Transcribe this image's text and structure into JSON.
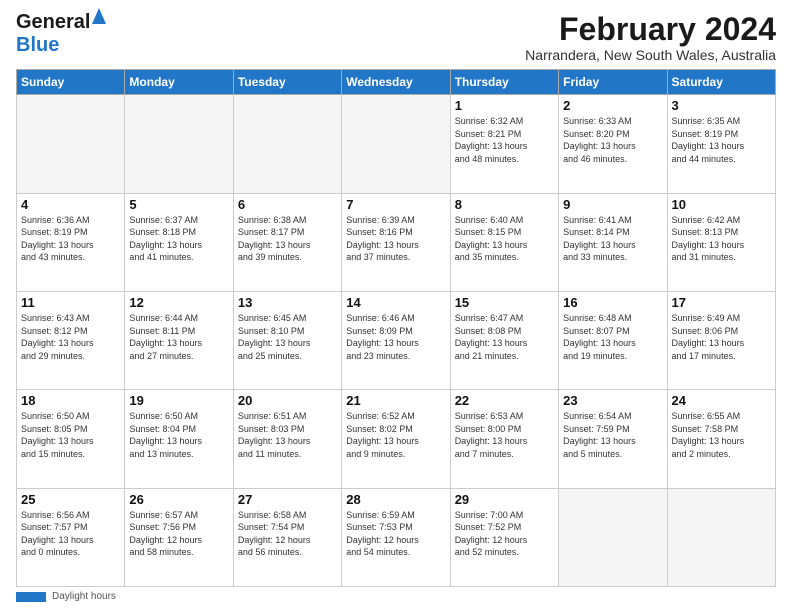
{
  "header": {
    "logo_line1": "General",
    "logo_line2": "Blue",
    "title": "February 2024",
    "subtitle": "Narrandera, New South Wales, Australia"
  },
  "days_of_week": [
    "Sunday",
    "Monday",
    "Tuesday",
    "Wednesday",
    "Thursday",
    "Friday",
    "Saturday"
  ],
  "weeks": [
    [
      {
        "day": "",
        "info": ""
      },
      {
        "day": "",
        "info": ""
      },
      {
        "day": "",
        "info": ""
      },
      {
        "day": "",
        "info": ""
      },
      {
        "day": "1",
        "info": "Sunrise: 6:32 AM\nSunset: 8:21 PM\nDaylight: 13 hours\nand 48 minutes."
      },
      {
        "day": "2",
        "info": "Sunrise: 6:33 AM\nSunset: 8:20 PM\nDaylight: 13 hours\nand 46 minutes."
      },
      {
        "day": "3",
        "info": "Sunrise: 6:35 AM\nSunset: 8:19 PM\nDaylight: 13 hours\nand 44 minutes."
      }
    ],
    [
      {
        "day": "4",
        "info": "Sunrise: 6:36 AM\nSunset: 8:19 PM\nDaylight: 13 hours\nand 43 minutes."
      },
      {
        "day": "5",
        "info": "Sunrise: 6:37 AM\nSunset: 8:18 PM\nDaylight: 13 hours\nand 41 minutes."
      },
      {
        "day": "6",
        "info": "Sunrise: 6:38 AM\nSunset: 8:17 PM\nDaylight: 13 hours\nand 39 minutes."
      },
      {
        "day": "7",
        "info": "Sunrise: 6:39 AM\nSunset: 8:16 PM\nDaylight: 13 hours\nand 37 minutes."
      },
      {
        "day": "8",
        "info": "Sunrise: 6:40 AM\nSunset: 8:15 PM\nDaylight: 13 hours\nand 35 minutes."
      },
      {
        "day": "9",
        "info": "Sunrise: 6:41 AM\nSunset: 8:14 PM\nDaylight: 13 hours\nand 33 minutes."
      },
      {
        "day": "10",
        "info": "Sunrise: 6:42 AM\nSunset: 8:13 PM\nDaylight: 13 hours\nand 31 minutes."
      }
    ],
    [
      {
        "day": "11",
        "info": "Sunrise: 6:43 AM\nSunset: 8:12 PM\nDaylight: 13 hours\nand 29 minutes."
      },
      {
        "day": "12",
        "info": "Sunrise: 6:44 AM\nSunset: 8:11 PM\nDaylight: 13 hours\nand 27 minutes."
      },
      {
        "day": "13",
        "info": "Sunrise: 6:45 AM\nSunset: 8:10 PM\nDaylight: 13 hours\nand 25 minutes."
      },
      {
        "day": "14",
        "info": "Sunrise: 6:46 AM\nSunset: 8:09 PM\nDaylight: 13 hours\nand 23 minutes."
      },
      {
        "day": "15",
        "info": "Sunrise: 6:47 AM\nSunset: 8:08 PM\nDaylight: 13 hours\nand 21 minutes."
      },
      {
        "day": "16",
        "info": "Sunrise: 6:48 AM\nSunset: 8:07 PM\nDaylight: 13 hours\nand 19 minutes."
      },
      {
        "day": "17",
        "info": "Sunrise: 6:49 AM\nSunset: 8:06 PM\nDaylight: 13 hours\nand 17 minutes."
      }
    ],
    [
      {
        "day": "18",
        "info": "Sunrise: 6:50 AM\nSunset: 8:05 PM\nDaylight: 13 hours\nand 15 minutes."
      },
      {
        "day": "19",
        "info": "Sunrise: 6:50 AM\nSunset: 8:04 PM\nDaylight: 13 hours\nand 13 minutes."
      },
      {
        "day": "20",
        "info": "Sunrise: 6:51 AM\nSunset: 8:03 PM\nDaylight: 13 hours\nand 11 minutes."
      },
      {
        "day": "21",
        "info": "Sunrise: 6:52 AM\nSunset: 8:02 PM\nDaylight: 13 hours\nand 9 minutes."
      },
      {
        "day": "22",
        "info": "Sunrise: 6:53 AM\nSunset: 8:00 PM\nDaylight: 13 hours\nand 7 minutes."
      },
      {
        "day": "23",
        "info": "Sunrise: 6:54 AM\nSunset: 7:59 PM\nDaylight: 13 hours\nand 5 minutes."
      },
      {
        "day": "24",
        "info": "Sunrise: 6:55 AM\nSunset: 7:58 PM\nDaylight: 13 hours\nand 2 minutes."
      }
    ],
    [
      {
        "day": "25",
        "info": "Sunrise: 6:56 AM\nSunset: 7:57 PM\nDaylight: 13 hours\nand 0 minutes."
      },
      {
        "day": "26",
        "info": "Sunrise: 6:57 AM\nSunset: 7:56 PM\nDaylight: 12 hours\nand 58 minutes."
      },
      {
        "day": "27",
        "info": "Sunrise: 6:58 AM\nSunset: 7:54 PM\nDaylight: 12 hours\nand 56 minutes."
      },
      {
        "day": "28",
        "info": "Sunrise: 6:59 AM\nSunset: 7:53 PM\nDaylight: 12 hours\nand 54 minutes."
      },
      {
        "day": "29",
        "info": "Sunrise: 7:00 AM\nSunset: 7:52 PM\nDaylight: 12 hours\nand 52 minutes."
      },
      {
        "day": "",
        "info": ""
      },
      {
        "day": "",
        "info": ""
      }
    ]
  ],
  "footer": {
    "label": "Daylight hours"
  }
}
